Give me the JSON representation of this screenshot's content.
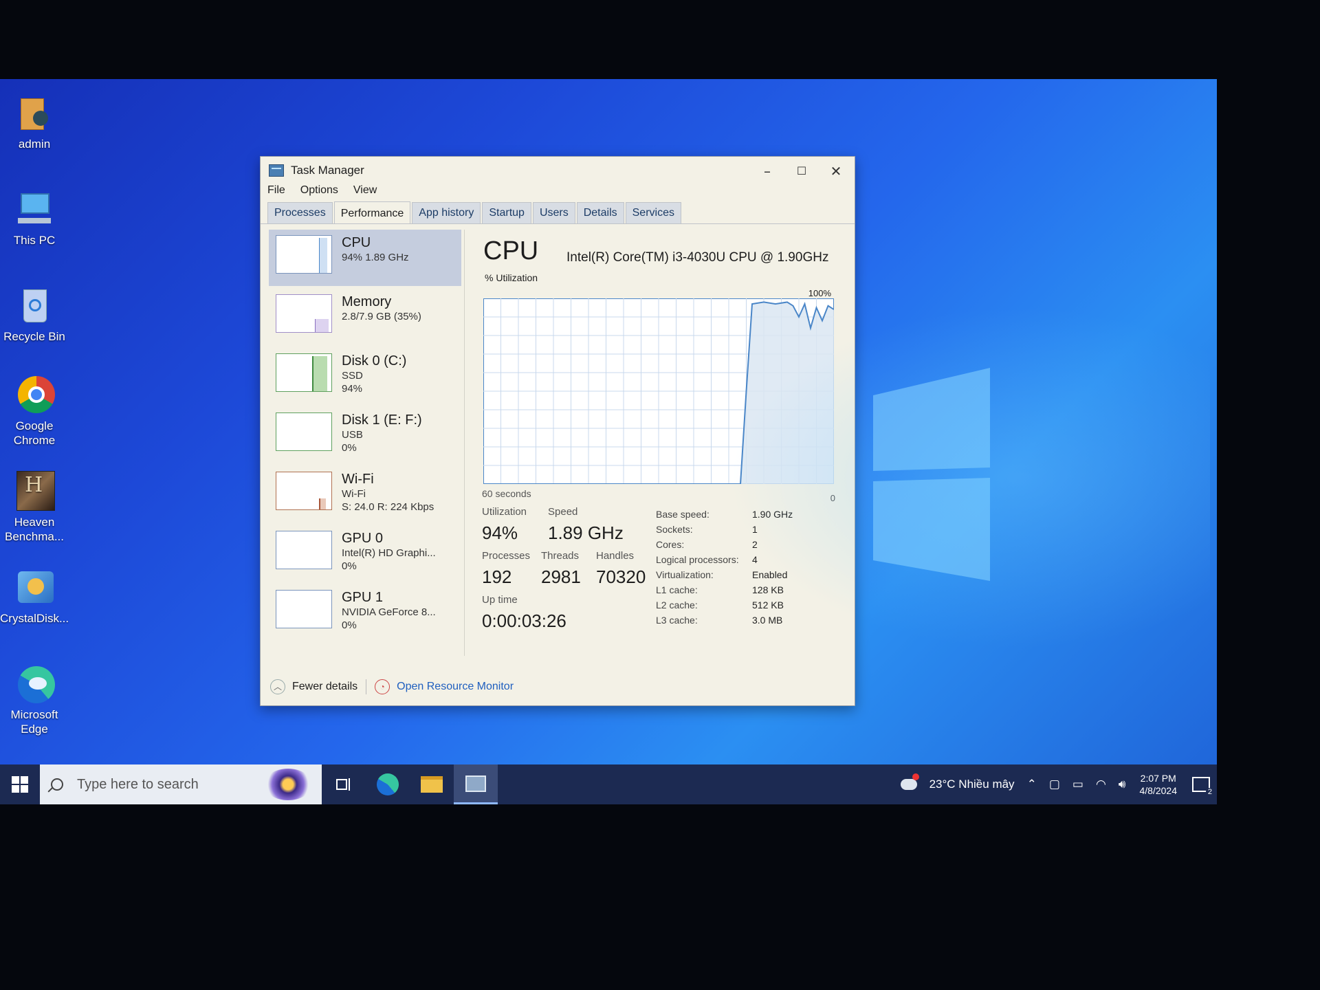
{
  "desktop": {
    "icons": [
      {
        "label": "admin",
        "icon": "user-folder-icon"
      },
      {
        "label": "This PC",
        "icon": "computer-icon"
      },
      {
        "label": "Recycle Bin",
        "icon": "recycle-bin-icon"
      },
      {
        "label": "Google Chrome",
        "icon": "chrome-icon"
      },
      {
        "label": "Heaven Benchma...",
        "icon": "heaven-benchmark-icon"
      },
      {
        "label": "CrystalDisk...",
        "icon": "crystaldisk-icon"
      },
      {
        "label": "Microsoft Edge",
        "icon": "edge-icon"
      }
    ]
  },
  "window": {
    "title": "Task Manager",
    "menu": [
      "File",
      "Options",
      "View"
    ],
    "tabs": [
      "Processes",
      "Performance",
      "App history",
      "Startup",
      "Users",
      "Details",
      "Services"
    ],
    "active_tab": "Performance"
  },
  "sidebar": {
    "items": [
      {
        "name": "CPU",
        "line1": "94%  1.89 GHz",
        "line2": "",
        "selected": true,
        "level": 0.94
      },
      {
        "name": "Memory",
        "line1": "2.8/7.9 GB (35%)",
        "line2": "",
        "selected": false,
        "level": 0.35
      },
      {
        "name": "Disk 0 (C:)",
        "line1": "SSD",
        "line2": "94%",
        "selected": false,
        "level": 0.94
      },
      {
        "name": "Disk 1 (E: F:)",
        "line1": "USB",
        "line2": "0%",
        "selected": false,
        "level": 0
      },
      {
        "name": "Wi-Fi",
        "line1": "Wi-Fi",
        "line2": "S: 24.0  R: 224 Kbps",
        "selected": false,
        "level": 0.3
      },
      {
        "name": "GPU 0",
        "line1": "Intel(R) HD Graphi...",
        "line2": "0%",
        "selected": false,
        "level": 0
      },
      {
        "name": "GPU 1",
        "line1": "NVIDIA GeForce 8...",
        "line2": "0%",
        "selected": false,
        "level": 0
      }
    ]
  },
  "cpu": {
    "title": "CPU",
    "model": "Intel(R) Core(TM) i3-4030U CPU @ 1.90GHz",
    "graph_label": "% Utilization",
    "graph_max_label": "100%",
    "graph_time_label": "60 seconds",
    "graph_min_label": "0",
    "stats": {
      "utilization_label": "Utilization",
      "utilization": "94%",
      "speed_label": "Speed",
      "speed": "1.89 GHz",
      "processes_label": "Processes",
      "processes": "192",
      "threads_label": "Threads",
      "threads": "2981",
      "handles_label": "Handles",
      "handles": "70320",
      "uptime_label": "Up time",
      "uptime": "0:00:03:26"
    },
    "specs": [
      {
        "label": "Base speed:",
        "value": "1.90 GHz"
      },
      {
        "label": "Sockets:",
        "value": "1"
      },
      {
        "label": "Cores:",
        "value": "2"
      },
      {
        "label": "Logical processors:",
        "value": "4"
      },
      {
        "label": "Virtualization:",
        "value": "Enabled"
      },
      {
        "label": "L1 cache:",
        "value": "128 KB"
      },
      {
        "label": "L2 cache:",
        "value": "512 KB"
      },
      {
        "label": "L3 cache:",
        "value": "3.0 MB"
      }
    ]
  },
  "chart_data": {
    "type": "area",
    "x": [
      0,
      5,
      10,
      15,
      20,
      25,
      30,
      35,
      40,
      44,
      45,
      46,
      48,
      50,
      52,
      53,
      54,
      55,
      56,
      57,
      58,
      59,
      60
    ],
    "values": [
      0,
      0,
      0,
      0,
      0,
      0,
      0,
      0,
      0,
      0,
      50,
      97,
      98,
      97,
      98,
      96,
      90,
      97,
      84,
      95,
      88,
      96,
      94
    ],
    "xlabel": "60 seconds",
    "ylabel": "% Utilization",
    "ylim": [
      0,
      100
    ],
    "grid": true
  },
  "footer": {
    "fewer_details": "Fewer details",
    "open_monitor": "Open Resource Monitor"
  },
  "taskbar": {
    "search_placeholder": "Type here to search",
    "weather": "23°C  Nhiều mây",
    "time": "2:07 PM",
    "date": "4/8/2024",
    "notification_count": "2"
  },
  "colors": {
    "graph_line": "#4a86c8",
    "graph_fill": "#dbe6f2",
    "graph_grid": "#c8d8ec",
    "accent_link": "#1f5fbf"
  }
}
